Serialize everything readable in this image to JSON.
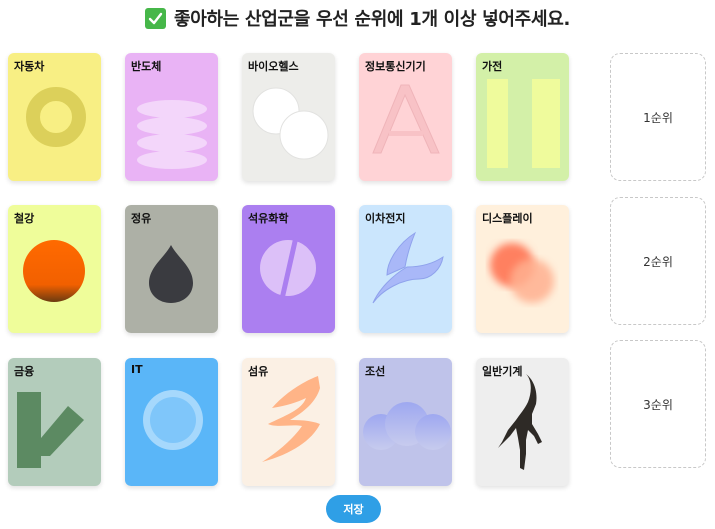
{
  "header": {
    "title": "좋아하는 산업군을 우선 순위에 1개 이상 넣어주세요."
  },
  "cards": [
    {
      "label": "자동차",
      "bg": "#f8ef84"
    },
    {
      "label": "반도체",
      "bg": "#e9b3f5"
    },
    {
      "label": "바이오헬스",
      "bg": "#ededea"
    },
    {
      "label": "정보통신기기",
      "bg": "#ffd3d6"
    },
    {
      "label": "가전",
      "bg": "#d3f0a8"
    },
    {
      "label": "철강",
      "bg": "#effd9a"
    },
    {
      "label": "정유",
      "bg": "#adb0a6"
    },
    {
      "label": "석유화학",
      "bg": "#ab7ff0"
    },
    {
      "label": "이차전지",
      "bg": "#cbe6fd"
    },
    {
      "label": "디스플레이",
      "bg": "#fff0dc"
    },
    {
      "label": "금융",
      "bg": "#b3ccbb"
    },
    {
      "label": "IT",
      "bg": "#5ab6f8"
    },
    {
      "label": "섬유",
      "bg": "#fbf0e4"
    },
    {
      "label": "조선",
      "bg": "#bfc3ea"
    },
    {
      "label": "일반기계",
      "bg": "#eeeeee"
    }
  ],
  "slots": [
    {
      "label": "1순위"
    },
    {
      "label": "2순위"
    },
    {
      "label": "3순위"
    }
  ],
  "save_label": "저장"
}
